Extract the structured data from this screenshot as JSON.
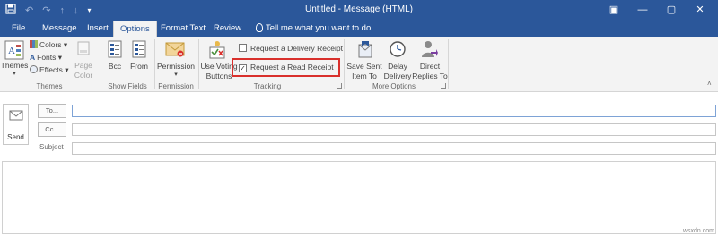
{
  "window": {
    "title": "Untitled - Message (HTML)",
    "controls": [
      "▣",
      "—",
      "▢",
      "✕"
    ]
  },
  "qat": [
    "save-icon",
    "undo-icon",
    "redo-icon",
    "up-icon",
    "down-icon",
    "customize-icon"
  ],
  "tabs": {
    "file": "File",
    "message": "Message",
    "insert": "Insert",
    "options": "Options",
    "format_text": "Format Text",
    "review": "Review",
    "tell_me": "Tell me what you want to do..."
  },
  "ribbon": {
    "themes": {
      "themes_btn": "Themes",
      "colors": "Colors",
      "fonts": "Fonts",
      "effects": "Effects",
      "page_color_1": "Page",
      "page_color_2": "Color",
      "group": "Themes"
    },
    "show_fields": {
      "bcc": "Bcc",
      "from": "From",
      "group": "Show Fields"
    },
    "permission": {
      "btn": "Permission",
      "group": "Permission"
    },
    "tracking": {
      "use_voting_1": "Use Voting",
      "use_voting_2": "Buttons",
      "delivery_receipt": "Request a Delivery Receipt",
      "delivery_checked": false,
      "read_receipt": "Request a Read Receipt",
      "read_checked": true,
      "group": "Tracking"
    },
    "more_options": {
      "save_sent_1": "Save Sent",
      "save_sent_2": "Item To",
      "delay_1": "Delay",
      "delay_2": "Delivery",
      "direct_1": "Direct",
      "direct_2": "Replies To",
      "group": "More Options"
    }
  },
  "compose": {
    "send": "Send",
    "to": "To...",
    "cc": "Cc...",
    "subject_label": "Subject",
    "to_value": "",
    "cc_value": "",
    "subject_value": ""
  },
  "watermark": "wsxdn.com",
  "colors": {
    "accent": "#2b579a",
    "ribbon_bg": "#f3f3f3",
    "highlight": "#d9302c"
  }
}
